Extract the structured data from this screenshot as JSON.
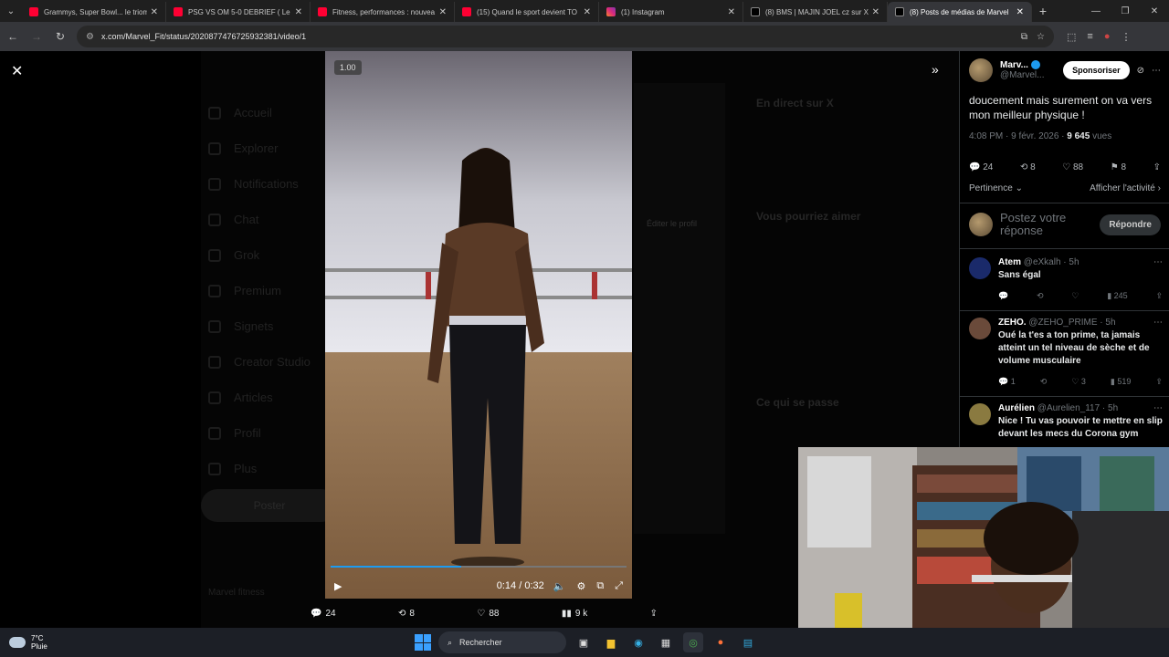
{
  "browser": {
    "tabs": [
      {
        "title": "Grammys, Super Bowl... le triomphe",
        "favicon": "youtube-icon",
        "active": false
      },
      {
        "title": "PSG VS OM 5-0 DEBRIEF ( Le Cl",
        "favicon": "youtube-icon",
        "active": false
      },
      {
        "title": "Fitness, performances : nouvea",
        "favicon": "youtube-icon",
        "active": false
      },
      {
        "title": "(15) Quand le sport devient TO",
        "favicon": "youtube-icon",
        "active": false
      },
      {
        "title": "(1) Instagram",
        "favicon": "instagram-icon",
        "active": false
      },
      {
        "title": "(8) BMS | MAJIN JOEL cz sur X",
        "favicon": "x-icon",
        "active": false
      },
      {
        "title": "(8) Posts de médias de Marvel",
        "favicon": "x-icon",
        "active": true
      }
    ],
    "url": "x.com/Marvel_Fit/status/2020877476725932381/video/1"
  },
  "video": {
    "speed": "1.00",
    "time": "0:14 / 0:32",
    "progress": 0.44
  },
  "engagement": {
    "replies": "24",
    "reposts": "8",
    "likes": "88",
    "views": "9 k"
  },
  "background": {
    "nav": [
      "Accueil",
      "Explorer",
      "Notifications",
      "Chat",
      "Grok",
      "Premium",
      "Signets",
      "Creator Studio",
      "Articles",
      "Profil",
      "Plus"
    ],
    "post_button": "Poster",
    "live": "En direct sur X",
    "suggest": "Vous pourriez aimer",
    "happening": "Ce qui se passe",
    "edit_profile": "Éditer le profil",
    "user": "Marvel fitness"
  },
  "panel": {
    "author_name": "Marv...",
    "author_handle": "@Marvel...",
    "sponsor_label": "Sponsoriser",
    "tweet_text": "doucement mais surement on va vers mon meilleur physique !",
    "timestamp": "4:08 PM · 9 févr. 2026 · ",
    "views_count": "9 645",
    "views_label": " vues",
    "stats": {
      "replies": "24",
      "reposts": "8",
      "likes": "88",
      "bookmarks": "8"
    },
    "sort_label": "Pertinence",
    "activity_label": "Afficher l'activité",
    "reply_placeholder": "Postez votre réponse",
    "reply_button": "Répondre",
    "replies": [
      {
        "name": "Atem",
        "handle": "@eXkalh · 5h",
        "text": "Sans égal",
        "reply": "",
        "repost": "",
        "like": "",
        "views": "245",
        "avatar_color": "#1a2a6a"
      },
      {
        "name": "ZEHO.",
        "handle": "@ZEHO_PRIME · 5h",
        "text": "Oué la t'es a ton prime, ta jamais atteint un tel niveau de sèche et de volume musculaire",
        "reply": "1",
        "repost": "",
        "like": "3",
        "views": "519",
        "avatar_color": "#6a4a3a"
      },
      {
        "name": "Aurélien",
        "handle": "@Aurelien_117 · 5h",
        "text": "Nice ! Tu vas pouvoir te mettre en slip devant les mecs du Corona gym",
        "reply": "",
        "repost": "",
        "like": "",
        "views": "",
        "avatar_color": "#8a7a40"
      }
    ]
  },
  "taskbar": {
    "temp": "7°C",
    "weather": "Pluie",
    "search_placeholder": "Rechercher"
  }
}
